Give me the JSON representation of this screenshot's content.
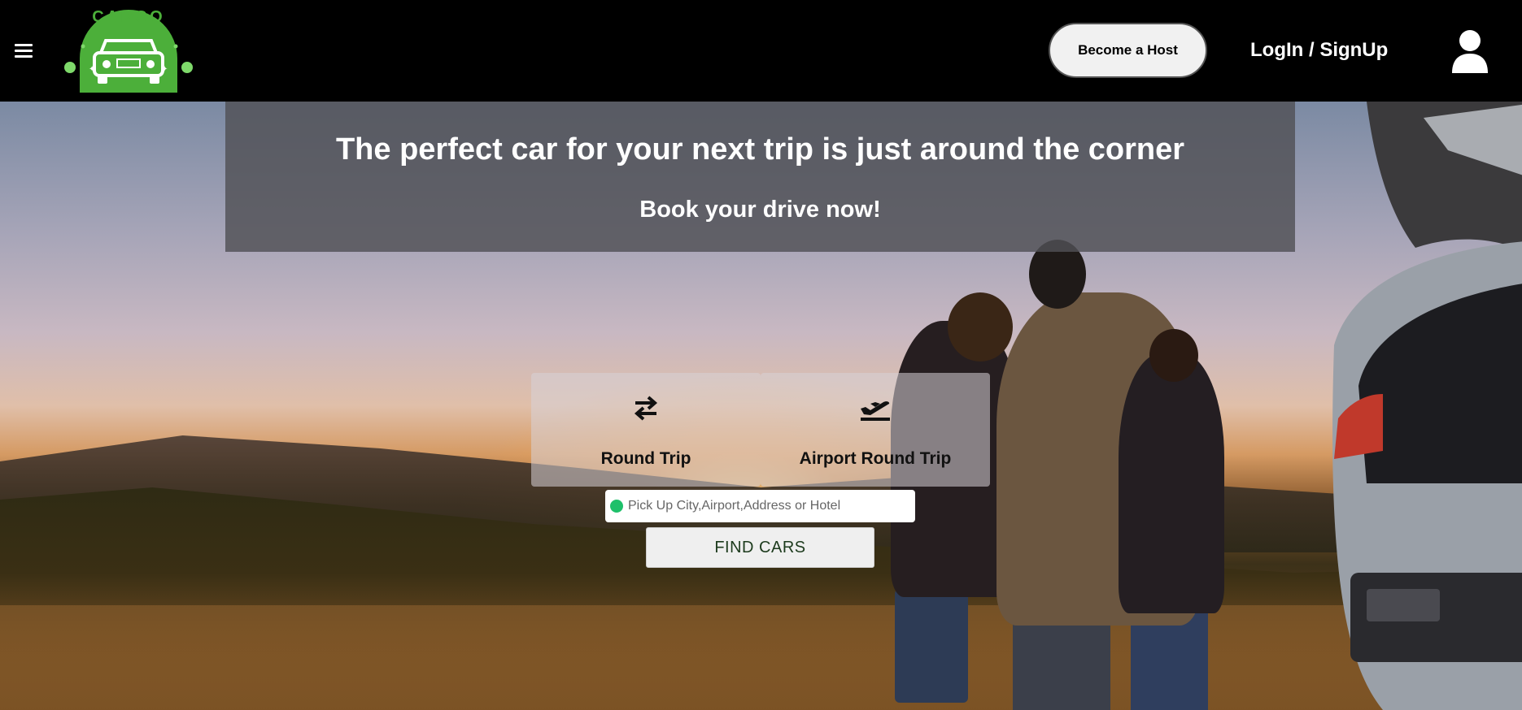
{
  "header": {
    "menu_icon": "hamburger-icon",
    "logo_text": "CARGO",
    "become_host_label": "Become a Host",
    "login_label": "LogIn / SignUp",
    "user_icon": "user-icon"
  },
  "hero": {
    "headline": "The perfect car for your next trip is just around the corner",
    "subheadline": "Book your drive now!"
  },
  "trip_types": [
    {
      "label": "Round Trip",
      "icon": "swap-arrows-icon"
    },
    {
      "label": "Airport Round Trip",
      "icon": "plane-departure-icon"
    }
  ],
  "search": {
    "pickup_placeholder": "Pick Up City,Airport,Address or Hotel",
    "pickup_value": "",
    "find_button_label": "FIND CARS"
  },
  "colors": {
    "header_bg": "#000000",
    "brand_green": "#4caf3a",
    "pickup_dot": "#1ec06a"
  }
}
